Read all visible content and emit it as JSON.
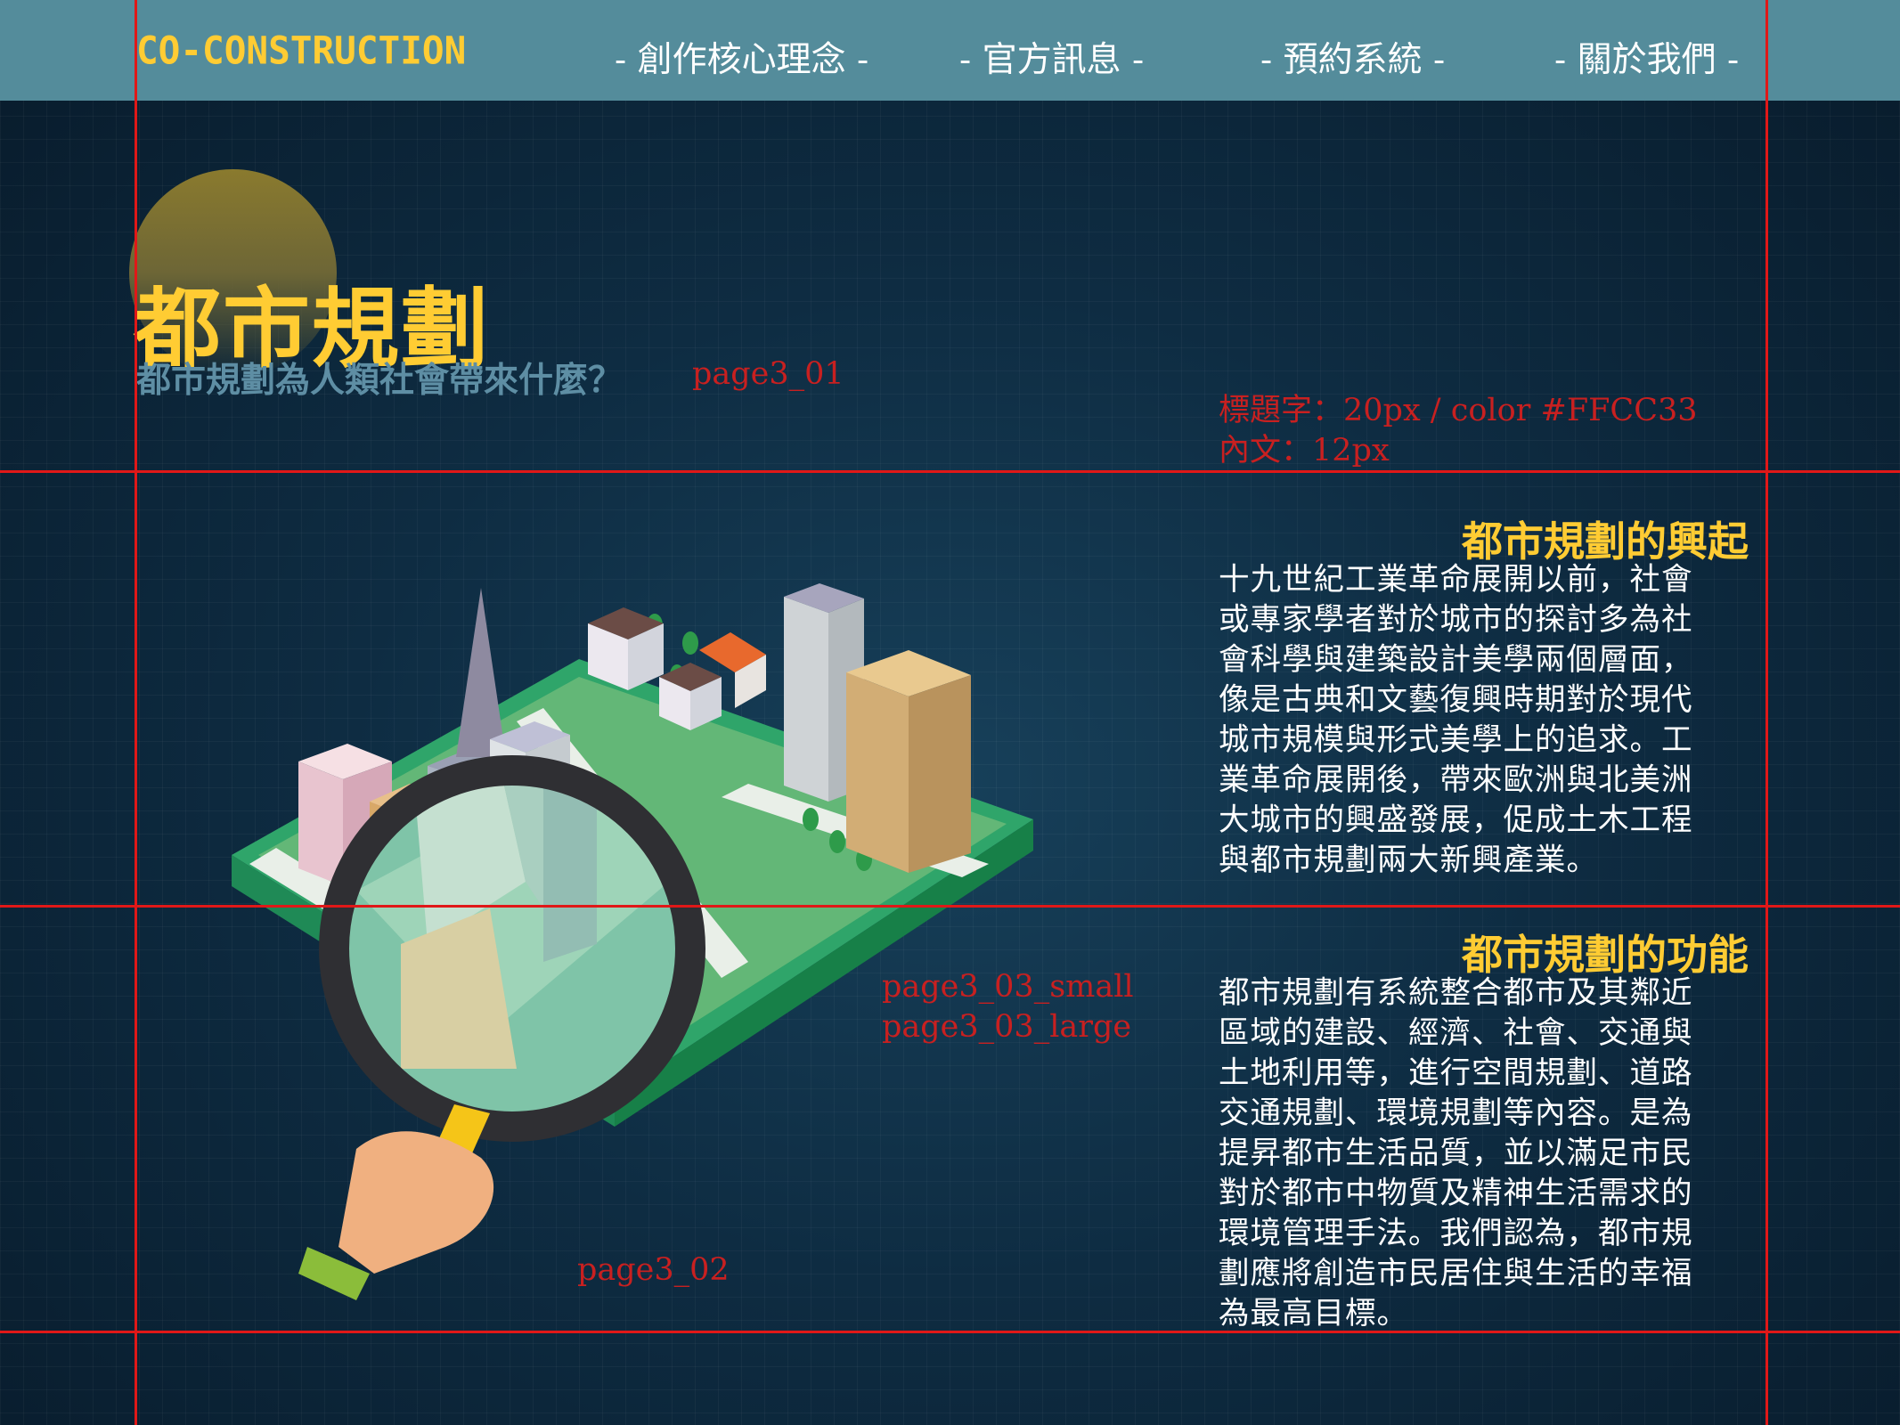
{
  "header": {
    "logo": "CO-CONSTRUCTION",
    "nav": [
      {
        "label": "- 創作核心理念 -"
      },
      {
        "label": "- 官方訊息 -"
      },
      {
        "label": "- 預約系統 -"
      },
      {
        "label": "- 關於我們 -"
      }
    ]
  },
  "hero": {
    "title": "都市規劃",
    "subtitle": "都市規劃為人類社會帶來什麼？"
  },
  "annotations": {
    "page3_01": "page3_01",
    "style_title": "標題字：20px  / color #FFCC33",
    "style_body": "內文：12px",
    "page3_03_small": "page3_03_small",
    "page3_03_large": "page3_03_large",
    "page3_02": "page3_02"
  },
  "sections": [
    {
      "title": "都市規劃的興起",
      "body": "十九世紀工業革命展開以前，社會或專家學者對於城市的探討多為社會科學與建築設計美學兩個層面，像是古典和文藝復興時期對於現代城市規模與形式美學上的追求。工業革命展開後，帶來歐洲與北美洲大城市的興盛發展，促成土木工程與都市規劃兩大新興產業。"
    },
    {
      "title": "都市規劃的功能",
      "body": "都市規劃有系統整合都市及其鄰近區域的建設、經濟、社會、交通與土地利用等，進行空間規劃、道路交通規劃、環境規劃等內容。是為提昇都市生活品質，並以滿足市民對於都市中物質及精神生活需求的環境管理手法。我們認為，都市規劃應將創造市民居住與生活的幸福為最高目標。"
    }
  ],
  "colors": {
    "accent": "#FFCC33",
    "navbar": "#548C9B",
    "guide": "#E01818"
  },
  "icons": [
    "city-block-illustration",
    "magnifier-icon",
    "hand-icon"
  ]
}
